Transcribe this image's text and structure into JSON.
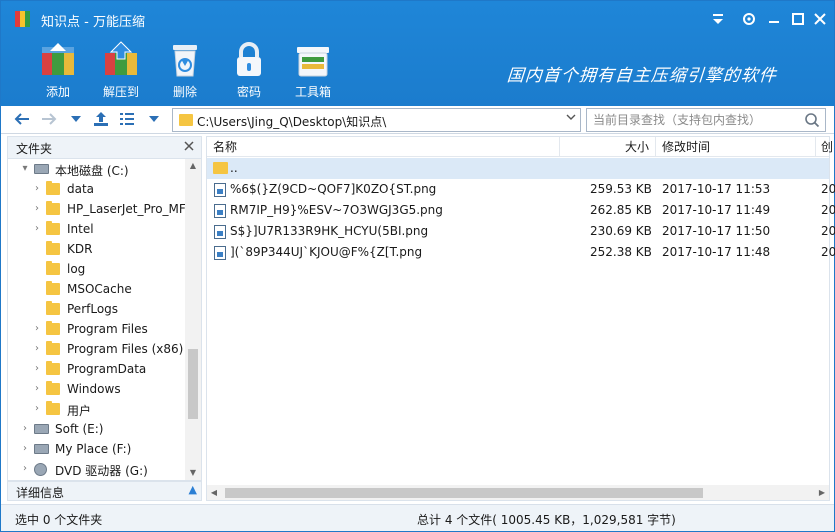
{
  "window": {
    "title": "知识点 - 万能压缩",
    "slogan": "国内首个拥有自主压缩引擎的软件"
  },
  "toolbar": [
    {
      "label": "添加",
      "icon": "add-archive-icon"
    },
    {
      "label": "解压到",
      "icon": "extract-icon"
    },
    {
      "label": "删除",
      "icon": "delete-icon"
    },
    {
      "label": "密码",
      "icon": "lock-icon"
    },
    {
      "label": "工具箱",
      "icon": "toolbox-icon"
    }
  ],
  "address": {
    "path": "C:\\Users\\Jing_Q\\Desktop\\知识点\\",
    "search_placeholder": "当前目录查找（支持包内查找）"
  },
  "left_panel": {
    "title": "文件夹",
    "details_label": "详细信息",
    "tree": [
      {
        "label": "本地磁盘 (C:)",
        "type": "drive",
        "level": 0,
        "expanded": true
      },
      {
        "label": "data",
        "type": "folder",
        "level": 1,
        "has_children": true
      },
      {
        "label": "HP_LaserJet_Pro_MF",
        "type": "folder",
        "level": 1,
        "has_children": true
      },
      {
        "label": "Intel",
        "type": "folder",
        "level": 1,
        "has_children": true
      },
      {
        "label": "KDR",
        "type": "folder",
        "level": 1,
        "has_children": false
      },
      {
        "label": "log",
        "type": "folder",
        "level": 1,
        "has_children": false
      },
      {
        "label": "MSOCache",
        "type": "folder",
        "level": 1,
        "has_children": false
      },
      {
        "label": "PerfLogs",
        "type": "folder",
        "level": 1,
        "has_children": false
      },
      {
        "label": "Program Files",
        "type": "folder",
        "level": 1,
        "has_children": true
      },
      {
        "label": "Program Files (x86)",
        "type": "folder",
        "level": 1,
        "has_children": true
      },
      {
        "label": "ProgramData",
        "type": "folder",
        "level": 1,
        "has_children": true
      },
      {
        "label": "Windows",
        "type": "folder",
        "level": 1,
        "has_children": true
      },
      {
        "label": "用户",
        "type": "folder",
        "level": 1,
        "has_children": true
      },
      {
        "label": "Soft (E:)",
        "type": "drive",
        "level": 0,
        "has_children": true
      },
      {
        "label": "My Place (F:)",
        "type": "drive",
        "level": 0,
        "has_children": true
      },
      {
        "label": "DVD 驱动器 (G:)",
        "type": "dvd",
        "level": 0,
        "has_children": true
      }
    ]
  },
  "file_list": {
    "columns": {
      "name": "名称",
      "size": "大小",
      "modified": "修改时间",
      "extra": "创"
    },
    "parent_label": "..",
    "files": [
      {
        "name": "%6$(}Z(9CD~QOF7]K0ZO{ST.png",
        "size": "259.53 KB",
        "modified": "2017-10-17 11:53",
        "extra": "20"
      },
      {
        "name": "RM7IP_H9}%ESV~7O3WGJ3G5.png",
        "size": "262.85 KB",
        "modified": "2017-10-17 11:49",
        "extra": "20"
      },
      {
        "name": "S$}]U7R133R9HK_HCYU(5BI.png",
        "size": "230.69 KB",
        "modified": "2017-10-17 11:50",
        "extra": "20"
      },
      {
        "name": "](`89P344UJ`KJOU@F%{Z[T.png",
        "size": "252.38 KB",
        "modified": "2017-10-17 11:48",
        "extra": "20"
      }
    ]
  },
  "status": {
    "left": "选中 0 个文件夹",
    "right": "总计 4 个文件( 1005.45 KB，1,029,581 字节)"
  },
  "colors": {
    "header": "#1f86d8",
    "selection": "#dbe9f7",
    "folder": "#f5c542"
  }
}
